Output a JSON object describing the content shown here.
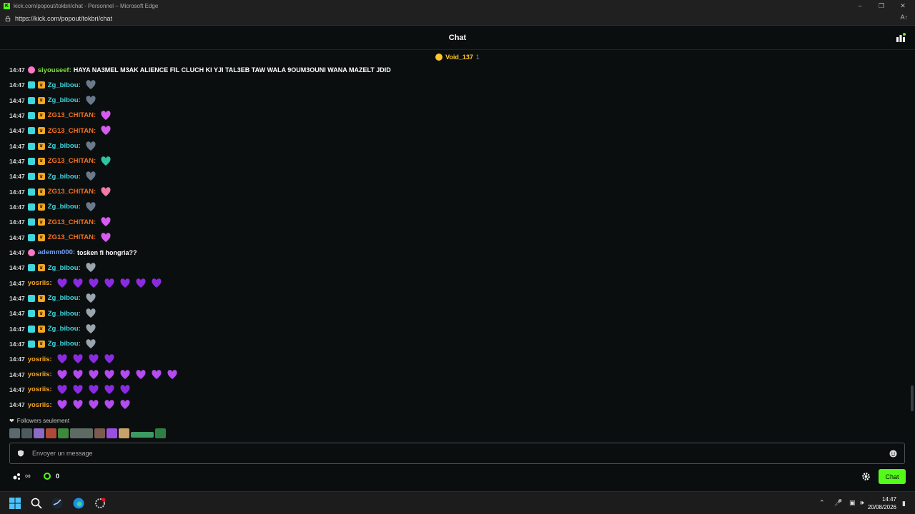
{
  "window": {
    "title": "kick.com/popout/tokbri/chat - Personnel – Microsoft Edge",
    "url": "https://kick.com/popout/tokbri/chat",
    "reader_icon": "A↑"
  },
  "header": {
    "title": "Chat",
    "users_icon": "users-icon"
  },
  "pinned": {
    "user": "Void_137",
    "count": "1"
  },
  "messages": [
    {
      "time": "14:47",
      "user": "siyouseef",
      "color": "#7ee03b",
      "badges": [
        "og"
      ],
      "text": "HAYA NA3MEL M3AK ALIENCE FIL CLUCH KI YJI TAL3EB TAW WALA 9OUM3OUNI WANA MAZELT JDID",
      "emotes": 0,
      "emote_color": ""
    },
    {
      "time": "14:47",
      "user": "Zg_bibou",
      "color": "#3fd7de",
      "badges": [
        "sub",
        "crown"
      ],
      "text": "",
      "emotes": 1,
      "emote_color": "#6b7a8a"
    },
    {
      "time": "14:47",
      "user": "Zg_bibou",
      "color": "#3fd7de",
      "badges": [
        "sub",
        "crown"
      ],
      "text": "",
      "emotes": 1,
      "emote_color": "#6b7a8a"
    },
    {
      "time": "14:47",
      "user": "ZG13_CHITAN",
      "color": "#f5731e",
      "badges": [
        "sub",
        "crown"
      ],
      "text": "",
      "emotes": 1,
      "emote_color": "#d65cf0"
    },
    {
      "time": "14:47",
      "user": "ZG13_CHITAN",
      "color": "#f5731e",
      "badges": [
        "sub",
        "crown"
      ],
      "text": "",
      "emotes": 1,
      "emote_color": "#d65cf0"
    },
    {
      "time": "14:47",
      "user": "Zg_bibou",
      "color": "#3fd7de",
      "badges": [
        "sub",
        "crown"
      ],
      "text": "",
      "emotes": 1,
      "emote_color": "#6b7a8a"
    },
    {
      "time": "14:47",
      "user": "ZG13_CHITAN",
      "color": "#f5731e",
      "badges": [
        "sub",
        "crown"
      ],
      "text": "",
      "emotes": 1,
      "emote_color": "#2ec4a0"
    },
    {
      "time": "14:47",
      "user": "Zg_bibou",
      "color": "#3fd7de",
      "badges": [
        "sub",
        "crown"
      ],
      "text": "",
      "emotes": 1,
      "emote_color": "#6b7a8a"
    },
    {
      "time": "14:47",
      "user": "ZG13_CHITAN",
      "color": "#f5731e",
      "badges": [
        "sub",
        "crown"
      ],
      "text": "",
      "emotes": 1,
      "emote_color": "#f07aa8"
    },
    {
      "time": "14:47",
      "user": "Zg_bibou",
      "color": "#3fd7de",
      "badges": [
        "sub",
        "crown"
      ],
      "text": "",
      "emotes": 1,
      "emote_color": "#6b7a8a"
    },
    {
      "time": "14:47",
      "user": "ZG13_CHITAN",
      "color": "#f5731e",
      "badges": [
        "sub",
        "crown"
      ],
      "text": "",
      "emotes": 1,
      "emote_color": "#d65cf0"
    },
    {
      "time": "14:47",
      "user": "ZG13_CHITAN",
      "color": "#f5731e",
      "badges": [
        "sub",
        "crown"
      ],
      "text": "",
      "emotes": 1,
      "emote_color": "#d65cf0"
    },
    {
      "time": "14:47",
      "user": "ademm000",
      "color": "#6fa0f5",
      "badges": [
        "og"
      ],
      "text": "tosken fi hongria??",
      "emotes": 0,
      "emote_color": ""
    },
    {
      "time": "14:47",
      "user": "Zg_bibou",
      "color": "#3fd7de",
      "badges": [
        "sub",
        "crown"
      ],
      "text": "",
      "emotes": 1,
      "emote_color": "#9aa5b0"
    },
    {
      "time": "14:47",
      "user": "yosriis",
      "color": "#f5a623",
      "badges": [],
      "text": "",
      "emotes": 7,
      "emote_color": "#8a2be2"
    },
    {
      "time": "14:47",
      "user": "Zg_bibou",
      "color": "#3fd7de",
      "badges": [
        "sub",
        "crown"
      ],
      "text": "",
      "emotes": 1,
      "emote_color": "#9aa5b0"
    },
    {
      "time": "14:47",
      "user": "Zg_bibou",
      "color": "#3fd7de",
      "badges": [
        "sub",
        "crown"
      ],
      "text": "",
      "emotes": 1,
      "emote_color": "#9aa5b0"
    },
    {
      "time": "14:47",
      "user": "Zg_bibou",
      "color": "#3fd7de",
      "badges": [
        "sub",
        "crown"
      ],
      "text": "",
      "emotes": 1,
      "emote_color": "#9aa5b0"
    },
    {
      "time": "14:47",
      "user": "Zg_bibou",
      "color": "#3fd7de",
      "badges": [
        "sub",
        "crown"
      ],
      "text": "",
      "emotes": 1,
      "emote_color": "#9aa5b0"
    },
    {
      "time": "14:47",
      "user": "yosriis",
      "color": "#f5a623",
      "badges": [],
      "text": "",
      "emotes": 4,
      "emote_color": "#8a2be2"
    },
    {
      "time": "14:47",
      "user": "yosriis",
      "color": "#f5a623",
      "badges": [],
      "text": "",
      "emotes": 8,
      "emote_color": "#b44cf0"
    },
    {
      "time": "14:47",
      "user": "yosriis",
      "color": "#f5a623",
      "badges": [],
      "text": "",
      "emotes": 5,
      "emote_color": "#8a2be2"
    },
    {
      "time": "14:47",
      "user": "yosriis",
      "color": "#f5a623",
      "badges": [],
      "text": "",
      "emotes": 5,
      "emote_color": "#b44cf0"
    }
  ],
  "followers_only": "Followers seulement",
  "input": {
    "placeholder": "Envoyer un message"
  },
  "footer": {
    "infinity": "∞",
    "kicks_count": "0",
    "chat_button": "Chat"
  },
  "taskbar": {
    "time": "14:47",
    "date": "20/08/2026"
  },
  "colors": {
    "accent": "#53fc18",
    "background": "#0b0e0f"
  }
}
